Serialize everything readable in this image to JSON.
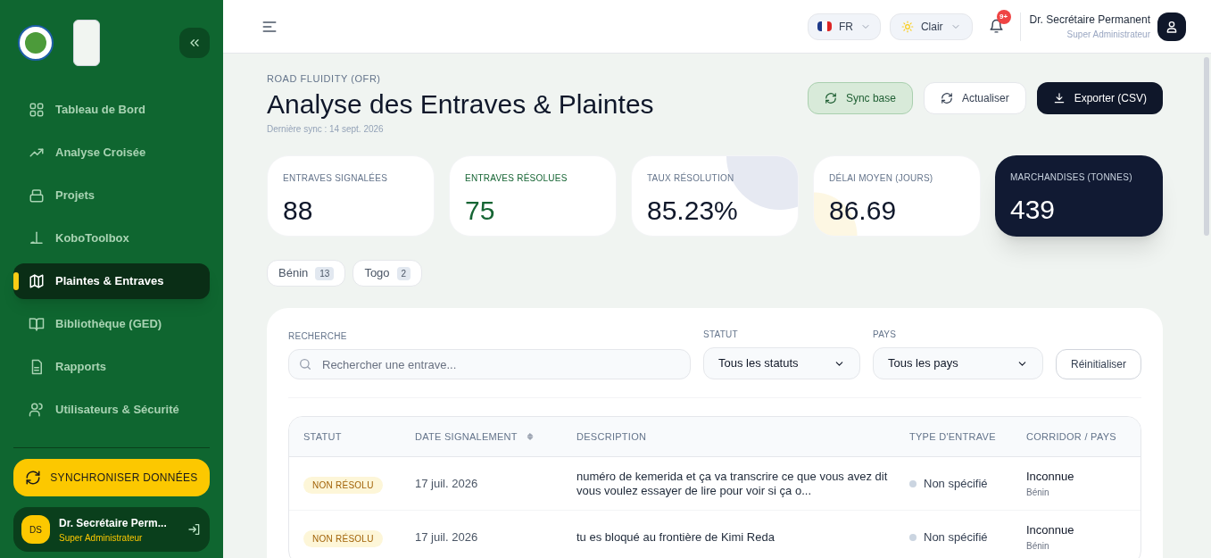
{
  "sidebar": {
    "items": [
      {
        "label": "Tableau de Bord",
        "selected": false
      },
      {
        "label": "Analyse Croisée",
        "selected": false
      },
      {
        "label": "Projets",
        "selected": false
      },
      {
        "label": "KoboToolbox",
        "selected": false
      },
      {
        "label": "Plaintes & Entraves",
        "selected": true
      },
      {
        "label": "Bibliothèque (GED)",
        "selected": false
      },
      {
        "label": "Rapports",
        "selected": false
      },
      {
        "label": "Utilisateurs & Sécurité",
        "selected": false
      }
    ],
    "sync_button": "SYNCHRONISER DONNÉES",
    "user": {
      "initials": "DS",
      "name": "Dr. Secrétaire Perm...",
      "role": "Super Administrateur"
    }
  },
  "header": {
    "language": "FR",
    "theme": "Clair",
    "notifications": "9+",
    "user": {
      "name": "Dr. Secrétaire Permanent",
      "role": "Super Administrateur"
    }
  },
  "page": {
    "eyebrow": "ROAD FLUIDITY (OFR)",
    "title": "Analyse des Entraves & Plaintes",
    "last_sync": "Dernière sync : 14 sept. 2026",
    "actions": [
      {
        "label": "Sync base",
        "kind": "soft"
      },
      {
        "label": "Actualiser",
        "kind": "outline"
      },
      {
        "label": "Exporter (CSV)",
        "kind": "dark"
      }
    ]
  },
  "stats": [
    {
      "label": "ENTRAVES SIGNALÉES",
      "value": "88",
      "kind": "plain"
    },
    {
      "label": "ENTRAVES RÉSOLUES",
      "value": "75",
      "kind": "success"
    },
    {
      "label": "TAUX RÉSOLUTION",
      "value": "85.23%",
      "kind": "plain"
    },
    {
      "label": "DÉLAI MOYEN (JOURS)",
      "value": "86.69",
      "kind": "plain"
    },
    {
      "label": "MARCHANDISES (TONNES)",
      "value": "439",
      "kind": "dark"
    }
  ],
  "countries": [
    {
      "label": "Bénin",
      "count": "13"
    },
    {
      "label": "Togo",
      "count": "2"
    }
  ],
  "filters": {
    "search_label": "RECHERCHE",
    "search_placeholder": "Rechercher une entrave...",
    "status_label": "STATUT",
    "status_value": "Tous les statuts",
    "country_label": "PAYS",
    "country_value": "Tous les pays",
    "reset": "Réinitialiser"
  },
  "table": {
    "columns": [
      "STATUT",
      "DATE SIGNALEMENT",
      "DESCRIPTION",
      "TYPE D'ENTRAVE",
      "CORRIDOR / PAYS"
    ],
    "rows": [
      {
        "status": "NON RÉSOLU",
        "date": "17 juil. 2026",
        "description": "numéro de kemerida et ça va transcrire ce que vous avez dit vous voulez essayer de lire pour voir si ça o...",
        "type": "Non spécifié",
        "color": "#cbd5e1",
        "corridor": "Inconnue",
        "country": "Bénin"
      },
      {
        "status": "NON RÉSOLU",
        "date": "17 juil. 2026",
        "description": "tu es bloqué au frontière de Kimi Reda",
        "type": "Non spécifié",
        "color": "#cbd5e1",
        "corridor": "Inconnue",
        "country": "Bénin"
      }
    ]
  }
}
